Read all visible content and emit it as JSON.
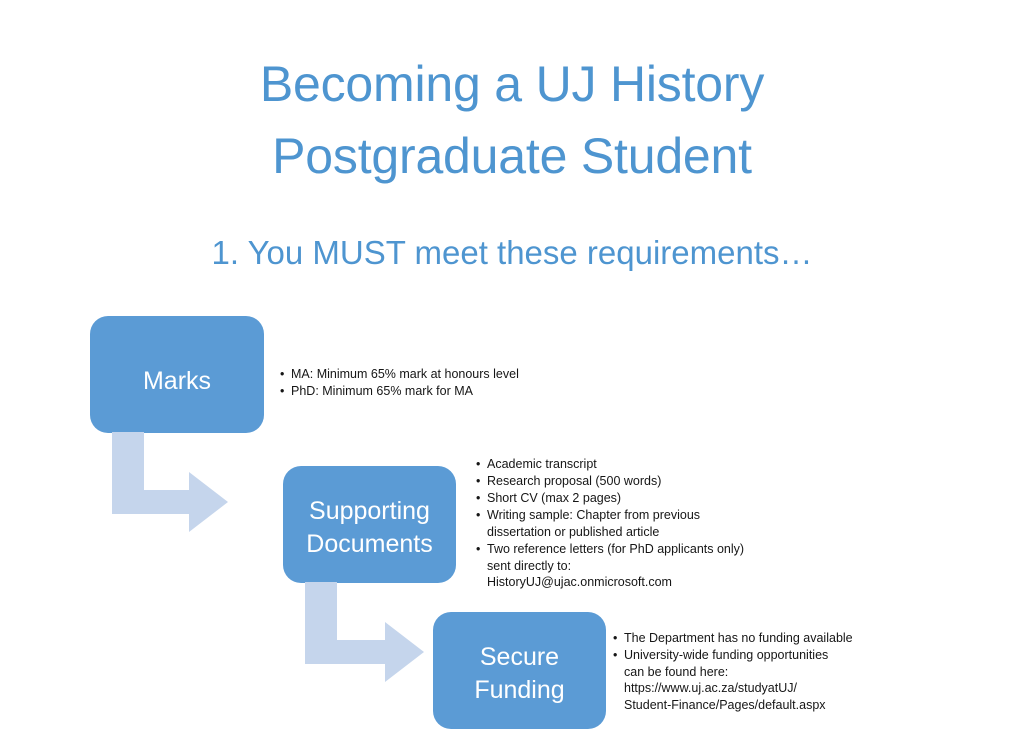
{
  "slide": {
    "title": "Becoming a UJ History\nPostgraduate Student",
    "subtitle": "1. You MUST meet these requirements…",
    "colors": {
      "accent_blue": "#5B9BD5",
      "title_blue": "#4E95D0",
      "arrow_blue": "#C5D5EC",
      "box_text": "#FFFFFF",
      "body_text": "#161616",
      "background": "#FFFFFF"
    }
  },
  "steps": [
    {
      "box_label": "Marks",
      "bullets": [
        "MA: Minimum 65% mark at honours level",
        "PhD: Minimum 65% mark for MA"
      ]
    },
    {
      "box_label": "Supporting\nDocuments",
      "bullets": [
        "Academic transcript",
        "Research proposal (500 words)",
        "Short CV (max 2 pages)",
        "Writing sample: Chapter from previous\ndissertation or published article",
        "Two reference letters (for PhD applicants only)\nsent directly to:\nHistoryUJ@ujac.onmicrosoft.com"
      ]
    },
    {
      "box_label": "Secure\nFunding",
      "bullets": [
        "The Department has no funding available",
        "University-wide funding opportunities\ncan be found here:\nhttps://www.uj.ac.za/studyatUJ/\nStudent-Finance/Pages/default.aspx"
      ]
    }
  ],
  "arrows": [
    {
      "name": "marks-to-supporting-documents",
      "shape": "elbow-down-right"
    },
    {
      "name": "supporting-documents-to-secure-funding",
      "shape": "elbow-down-right"
    }
  ]
}
